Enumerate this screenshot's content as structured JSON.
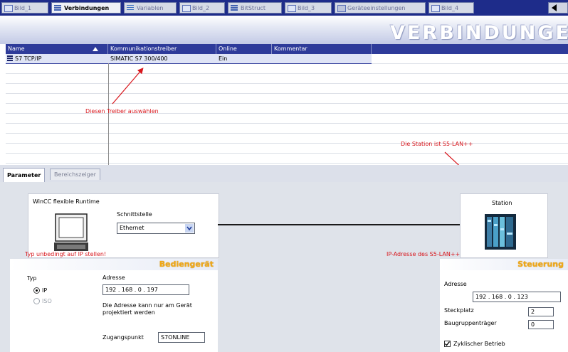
{
  "tabs": [
    {
      "label": "Bild_1"
    },
    {
      "label": "Verbindungen"
    },
    {
      "label": "Variablen"
    },
    {
      "label": "Bild_2"
    },
    {
      "label": "BitStruct"
    },
    {
      "label": "Bild_3"
    },
    {
      "label": "Geräteeinstellungen"
    },
    {
      "label": "Bild_4"
    }
  ],
  "page_title": "VERBINDUNGE",
  "table": {
    "columns": [
      "Name",
      "Kommunikationstreiber",
      "Online",
      "Kommentar"
    ],
    "rows": [
      {
        "name": "S7 TCP/IP",
        "driver": "SIMATIC S7 300/400",
        "online": "Ein",
        "comment": ""
      }
    ]
  },
  "annotations": {
    "driver": "Diesen Treiber auswählen",
    "station": "Die Station ist S5-LAN++",
    "typ": "Typ unbedingt auf IP stellen!",
    "ip": "IP-Adresse des S5-LAN++"
  },
  "param_tabs": [
    "Parameter",
    "Bereichszeiger"
  ],
  "runtime": {
    "title": "WinCC flexible Runtime",
    "interface_label": "Schnittstelle",
    "interface_value": "Ethernet"
  },
  "station": {
    "label": "Station"
  },
  "hmi": {
    "header": "Bediengerät",
    "type_label": "Typ",
    "type_options": [
      "IP",
      "ISO"
    ],
    "address_label": "Adresse",
    "address_value": "192 . 168 .   0 . 197",
    "address_note_1": "Die Adresse kann nur am Gerät",
    "address_note_2": "projektiert werden",
    "access_point_label": "Zugangspunkt",
    "access_point_value": "S7ONLINE"
  },
  "plc": {
    "header": "Steuerung",
    "address_label": "Adresse",
    "address_value": "192 . 168 .   0 . 123",
    "slot_label": "Steckplatz",
    "slot_value": "2",
    "rack_label": "Baugruppenträger",
    "rack_value": "0",
    "cyclic_label": "Zyklischer Betrieb"
  },
  "colors": {
    "tab_strip": "#1e2c8a",
    "table_header": "#2e3b9a",
    "annotation_red": "#d8161c",
    "panel_header_text": "#f0a818"
  }
}
